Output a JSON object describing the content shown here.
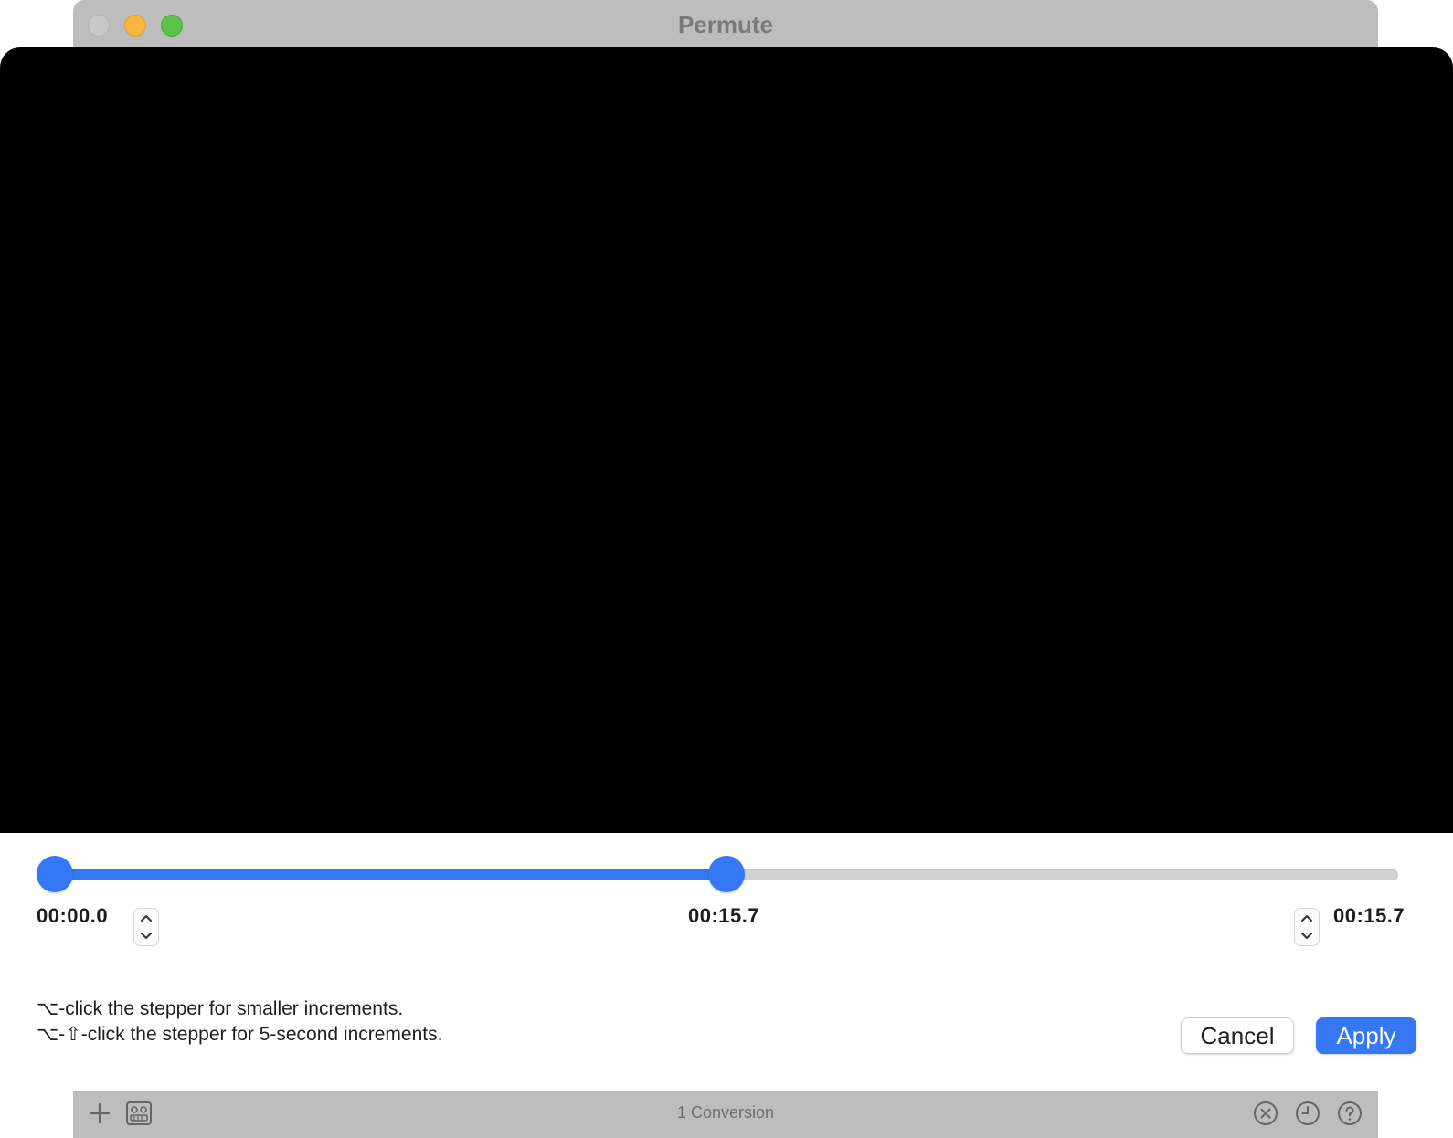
{
  "window": {
    "title": "Permute"
  },
  "sheet": {
    "trim": {
      "start_time": "00:00.0",
      "current_time": "00:15.7",
      "end_time": "00:15.7",
      "progress_fraction": 0.5
    },
    "hints": {
      "line1": "⌥-click the stepper for smaller increments.",
      "line2": "⌥-⇧-click the stepper for 5-second increments."
    },
    "buttons": {
      "cancel": "Cancel",
      "apply": "Apply"
    }
  },
  "toolbar": {
    "status": "1 Conversion"
  },
  "colors": {
    "accent": "#3478f6",
    "video_bg": "#000000",
    "chrome": "#bdbdbd"
  },
  "icons": [
    "plus-icon",
    "presets-icon",
    "cancel-circle-icon",
    "clock-icon",
    "help-icon",
    "chevron-up-icon",
    "chevron-down-icon"
  ]
}
